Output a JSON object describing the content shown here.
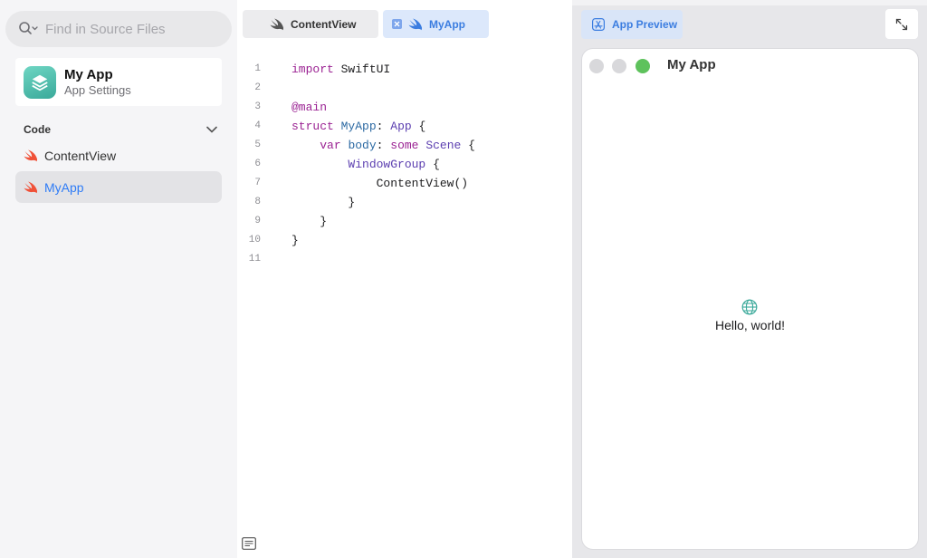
{
  "sidebar": {
    "search_placeholder": "Find in Source Files",
    "app": {
      "name": "My App",
      "subtitle": "App Settings"
    },
    "section": "Code",
    "items": [
      {
        "label": "ContentView",
        "active": false
      },
      {
        "label": "MyApp",
        "active": true
      }
    ]
  },
  "editor": {
    "tabs": [
      {
        "label": "ContentView",
        "active": false
      },
      {
        "label": "MyApp",
        "active": true
      }
    ],
    "line_numbers": [
      "1",
      "2",
      "3",
      "4",
      "5",
      "6",
      "7",
      "8",
      "9",
      "10",
      "11"
    ],
    "code": [
      "import SwiftUI",
      "",
      "@main",
      "struct MyApp: App {",
      "    var body: some Scene {",
      "        WindowGroup {",
      "            ContentView()",
      "        }",
      "    }",
      "}",
      ""
    ]
  },
  "preview": {
    "tab_label": "App Preview",
    "window_title": "My App",
    "content_text": "Hello, world!"
  },
  "colors": {
    "accent": "#2f7cf6",
    "keyword": "#9b2393",
    "type": "#5c3fb0",
    "name": "#2d6aa3",
    "app_icon": "#4cc0ad"
  },
  "icons": [
    "search-icon",
    "chevron-down-icon",
    "swift-icon",
    "close-icon",
    "app-store-icon",
    "expand-icon",
    "globe-icon",
    "document-icon"
  ]
}
